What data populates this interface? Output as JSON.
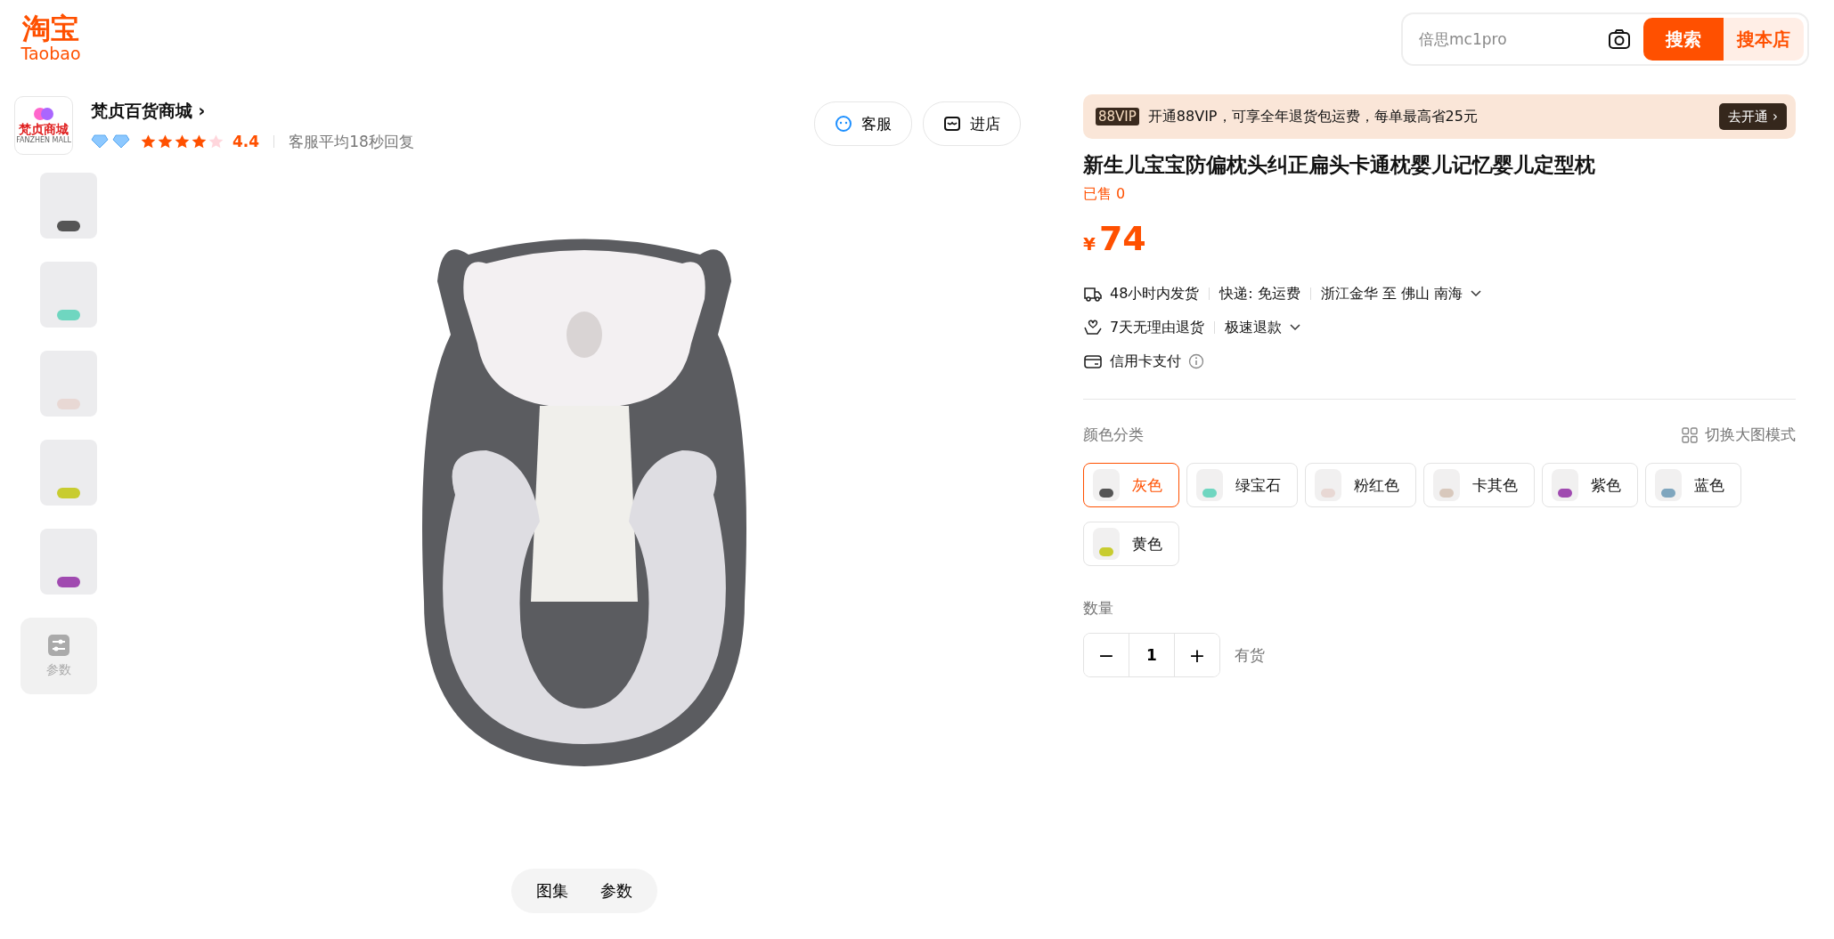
{
  "header": {
    "logo_text": "淘宝",
    "logo_sub": "Taobao",
    "search": {
      "placeholder": "倍思mc1pro"
    },
    "buttons": [
      "搜索",
      "搜本店"
    ]
  },
  "shop": {
    "logo_text": "梵贞商城",
    "logo_sub": "FANZHEN MALL",
    "name": "梵贞百货商城",
    "arrow": "›",
    "stars": 4,
    "rating": "4.4",
    "reply": "客服平均18秒回复",
    "buttons": [
      "客服",
      "进店"
    ]
  },
  "gallery": {
    "thumbnails": [
      {
        "color": "#555555"
      },
      {
        "color": "#6fd6c0"
      },
      {
        "color": "#e8d8d4"
      },
      {
        "color": "#c8cc30"
      },
      {
        "color": "#a04ab0"
      }
    ],
    "params_label": "参数",
    "tabs": [
      "图集",
      "参数"
    ]
  },
  "vip": {
    "badge": "88VIP",
    "text": "开通88VIP，可享全年退货包运费，每单最高省25元",
    "button": "去开通 ›"
  },
  "product": {
    "title": "新生儿宝宝防偏枕头纠正扁头卡通枕婴儿记忆婴儿定型枕",
    "sold": "已售 0",
    "currency": "¥",
    "price": "74"
  },
  "services": [
    {
      "kind": "truck",
      "parts": [
        "48小时内发货",
        "快递: 免运费",
        "浙江金华 至 佛山 南海"
      ],
      "dropdown": true,
      "info": false
    },
    {
      "kind": "return",
      "parts": [
        "7天无理由退货",
        "极速退款"
      ],
      "dropdown": true,
      "info": false
    },
    {
      "kind": "card",
      "parts": [
        "信用卡支付"
      ],
      "dropdown": false,
      "info": true
    }
  ],
  "options": {
    "label": "颜色分类",
    "switch_label": "切换大图模式",
    "items": [
      {
        "label": "灰色",
        "selected": true,
        "color": "#555555"
      },
      {
        "label": "绿宝石",
        "selected": false,
        "color": "#6fd6c0"
      },
      {
        "label": "粉红色",
        "selected": false,
        "color": "#e8d8d4"
      },
      {
        "label": "卡其色",
        "selected": false,
        "color": "#d8c8bc"
      },
      {
        "label": "紫色",
        "selected": false,
        "color": "#a04ab0"
      },
      {
        "label": "蓝色",
        "selected": false,
        "color": "#7fa6be"
      },
      {
        "label": "黄色",
        "selected": false,
        "color": "#c8cc30"
      }
    ]
  },
  "quantity": {
    "label": "数量",
    "minus": "−",
    "value": "1",
    "plus": "+",
    "stock": "有货"
  }
}
